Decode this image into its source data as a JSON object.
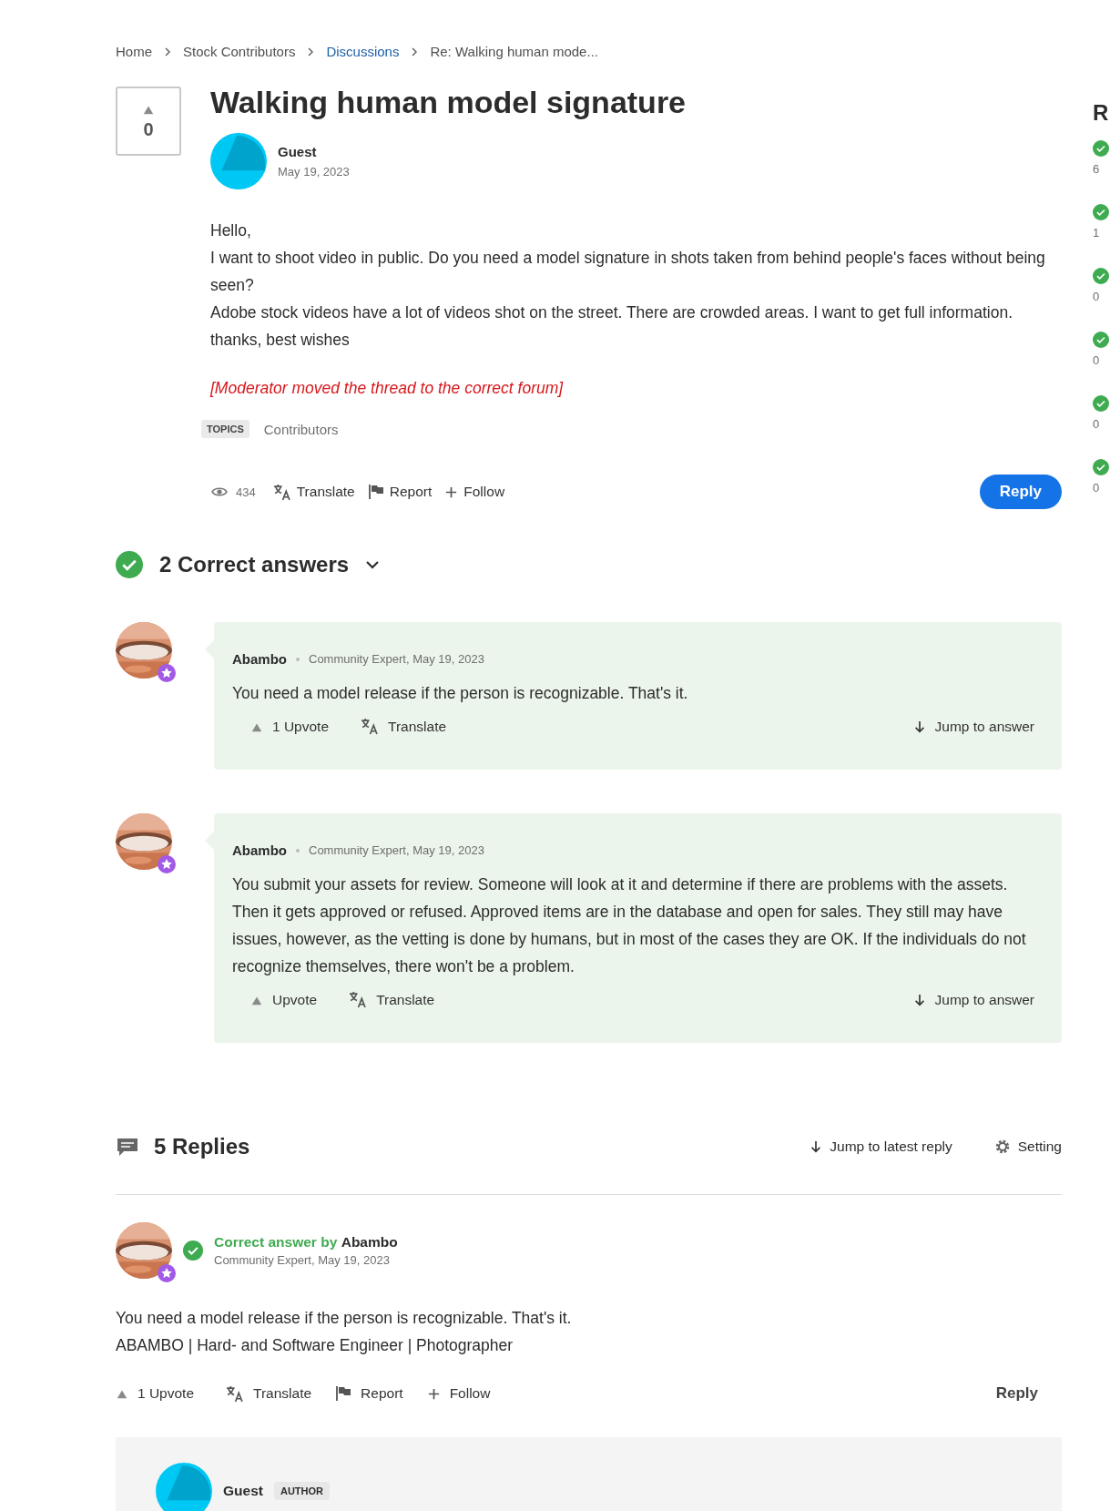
{
  "breadcrumbs": [
    {
      "label": "Home",
      "kind": "plain"
    },
    {
      "label": "Stock Contributors",
      "kind": "plain"
    },
    {
      "label": "Discussions",
      "kind": "link"
    },
    {
      "label": "Re: Walking human mode...",
      "kind": "current"
    }
  ],
  "question": {
    "votes": "0",
    "title": "Walking human model signature",
    "author": {
      "name": "Guest",
      "date": "May 19, 2023"
    },
    "body": [
      "Hello,",
      "I want to shoot video in public. Do you need a model signature in shots taken from behind people's faces without being seen?",
      "Adobe stock videos have a lot of videos shot on the street. There are crowded areas. I want to get full information.",
      "thanks, best wishes"
    ],
    "moderator_note": "[Moderator moved the thread to the correct forum]",
    "topics_label": "TOPICS",
    "topics": [
      "Contributors"
    ],
    "views": "434",
    "translate": "Translate",
    "report": "Report",
    "follow": "Follow",
    "reply_button": "Reply"
  },
  "correct_answers": {
    "heading": "2 Correct answers",
    "items": [
      {
        "author": "Abambo",
        "meta": "Community Expert, May 19, 2023",
        "body": "You need a model release if the person is recognizable. That's it.",
        "upvote": "1 Upvote",
        "translate": "Translate",
        "jump": "Jump to answer"
      },
      {
        "author": "Abambo",
        "meta": "Community Expert, May 19, 2023",
        "body": "You submit your assets for review. Someone will look at it and determine if there are problems with the assets. Then it gets approved or refused. Approved items are in the database and open for sales. They still may have issues, however, as the vetting is done by humans, but in most of the cases they are OK. If the individuals do not recognize themselves, there won't be a problem.",
        "upvote": "Upvote",
        "translate": "Translate",
        "jump": "Jump to answer"
      }
    ]
  },
  "replies": {
    "heading": "5 Replies",
    "jump": "Jump to latest reply",
    "setting": "Setting",
    "items": [
      {
        "kind": "expert",
        "label": "Correct answer by",
        "author": "Abambo",
        "meta": "Community Expert, May 19, 2023",
        "body": [
          "You need a model release if the person is recognizable. That's it.",
          "ABAMBO | Hard- and Software Engineer | Photographer"
        ],
        "upvote": "1 Upvote",
        "translate": "Translate",
        "report": "Report",
        "follow": "Follow",
        "reply": "Reply"
      },
      {
        "kind": "guest",
        "author": "Guest",
        "badge": "AUTHOR"
      }
    ]
  },
  "sidebar": {
    "title": "R",
    "items": [
      {
        "count": "6"
      },
      {
        "count": "1"
      },
      {
        "count": "0"
      },
      {
        "count": "0"
      },
      {
        "count": "0"
      },
      {
        "count": "0"
      }
    ]
  }
}
